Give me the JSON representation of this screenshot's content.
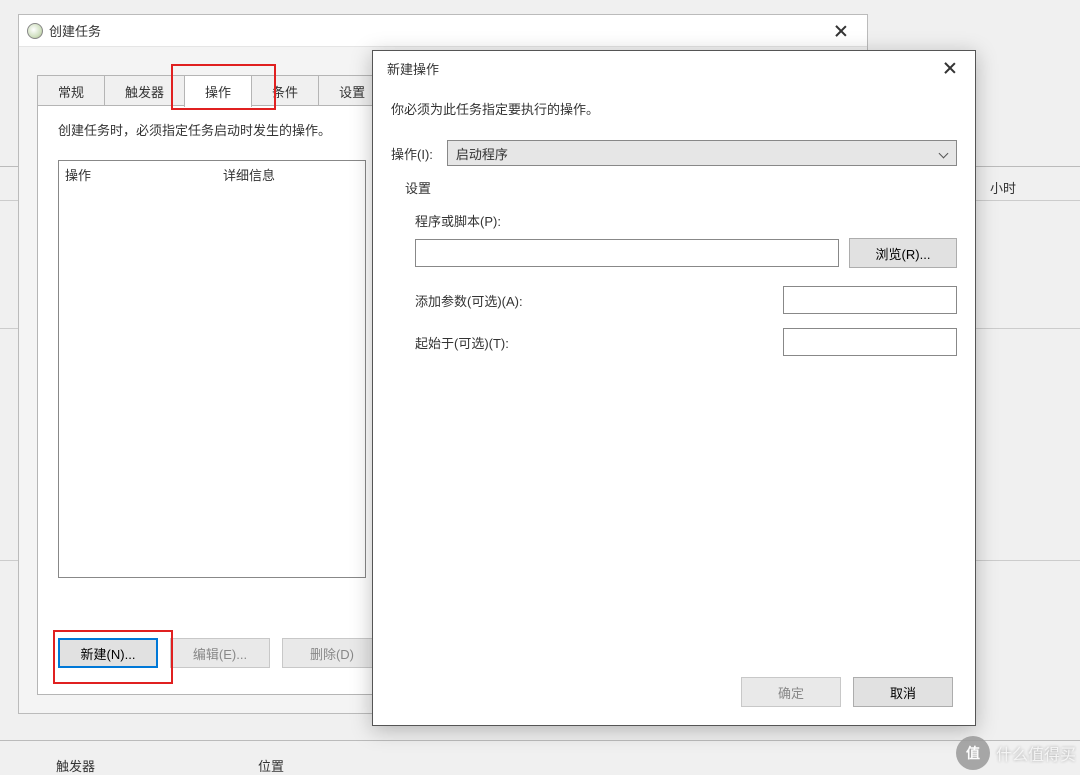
{
  "bg": {
    "hour_label": "小时",
    "trigger_label": "触发器",
    "location_label": "位置"
  },
  "createTask": {
    "title": "创建任务",
    "closeGlyph": "✕",
    "tabs": [
      "常规",
      "触发器",
      "操作",
      "条件",
      "设置"
    ],
    "activeTabIndex": 2,
    "description": "创建任务时，必须指定任务启动时发生的操作。",
    "columns": {
      "action": "操作",
      "detail": "详细信息"
    },
    "buttons": {
      "new": "新建(N)...",
      "edit": "编辑(E)...",
      "delete": "删除(D)"
    }
  },
  "newAction": {
    "title": "新建操作",
    "description": "你必须为此任务指定要执行的操作。",
    "actionLabel": "操作(I):",
    "actionValue": "启动程序",
    "settingsLabel": "设置",
    "programLabel": "程序或脚本(P):",
    "programValue": "",
    "browse": "浏览(R)...",
    "addArgsLabel": "添加参数(可选)(A):",
    "addArgsValue": "",
    "startInLabel": "起始于(可选)(T):",
    "startInValue": "",
    "ok": "确定",
    "cancel": "取消"
  },
  "watermark": {
    "badge": "值",
    "text": "什么值得买"
  }
}
